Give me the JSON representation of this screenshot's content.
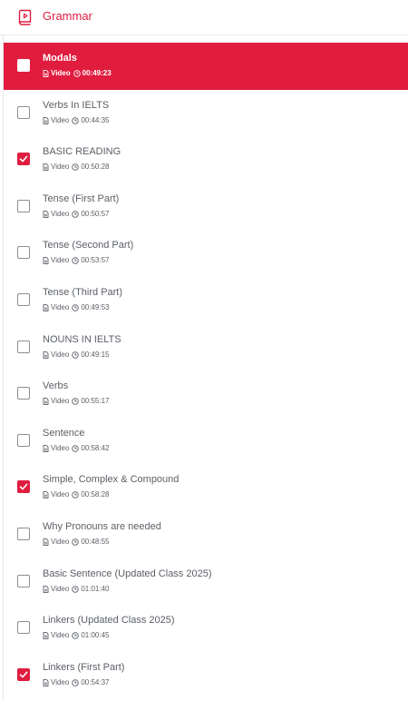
{
  "header": {
    "title": "Grammar",
    "icon": "book-icon",
    "accent": "#e01d3f"
  },
  "lessons": [
    {
      "title": "Modals",
      "type": "Video",
      "duration": "00:49:23",
      "state": "active"
    },
    {
      "title": "Verbs In IELTS",
      "type": "Video",
      "duration": "00:44:35",
      "state": "unchecked"
    },
    {
      "title": "BASIC READING",
      "type": "Video",
      "duration": "00:50:28",
      "state": "checked"
    },
    {
      "title": "Tense (First Part)",
      "type": "Video",
      "duration": "00:50:57",
      "state": "unchecked"
    },
    {
      "title": "Tense (Second Part)",
      "type": "Video",
      "duration": "00:53:57",
      "state": "unchecked"
    },
    {
      "title": "Tense (Third Part)",
      "type": "Video",
      "duration": "00:49:53",
      "state": "unchecked"
    },
    {
      "title": "NOUNS IN IELTS",
      "type": "Video",
      "duration": "00:49:15",
      "state": "unchecked"
    },
    {
      "title": "Verbs",
      "type": "Video",
      "duration": "00:55:17",
      "state": "unchecked"
    },
    {
      "title": "Sentence",
      "type": "Video",
      "duration": "00:58:42",
      "state": "unchecked"
    },
    {
      "title": "Simple, Complex & Compound",
      "type": "Video",
      "duration": "00:58:28",
      "state": "checked"
    },
    {
      "title": "Why Pronouns are needed",
      "type": "Video",
      "duration": "00:48:55",
      "state": "unchecked"
    },
    {
      "title": "Basic Sentence (Updated Class 2025)",
      "type": "Video",
      "duration": "01:01:40",
      "state": "unchecked"
    },
    {
      "title": "Linkers (Updated Class 2025)",
      "type": "Video",
      "duration": "01:00:45",
      "state": "unchecked"
    },
    {
      "title": "Linkers (First Part)",
      "type": "Video",
      "duration": "00:54:37",
      "state": "checked"
    }
  ]
}
